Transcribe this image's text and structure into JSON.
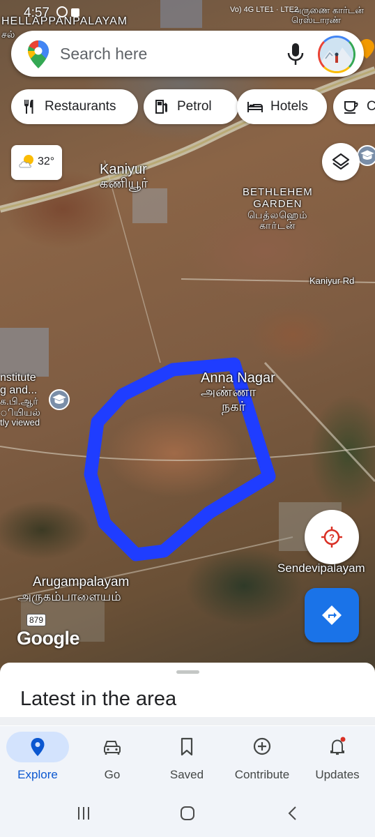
{
  "status_bar": {
    "time": "4:57",
    "network": "Vo) 4G LTE1 · LTE2",
    "battery": "%"
  },
  "search": {
    "placeholder": "Search here"
  },
  "chips": [
    {
      "label": "Restaurants",
      "icon": "fork-knife-icon"
    },
    {
      "label": "Petrol",
      "icon": "fuel-pump-icon"
    },
    {
      "label": "Hotels",
      "icon": "bed-icon"
    },
    {
      "label": "C",
      "icon": "coffee-cup-icon"
    }
  ],
  "weather": {
    "temp": "32°",
    "icon": "partly-cloudy-icon"
  },
  "map_labels": {
    "top_left": "HELLAPPANPALAYAM",
    "top_left_tamil": "சல்",
    "top_right_tamil": "அருணை கார்டன் ரெஸ்டாரண்",
    "kaniyur": "Kaniyur",
    "kaniyur_tamil": "கணியூர்",
    "bethlehem": "BETHLEHEM",
    "garden": "GARDEN",
    "bethlehem_tamil": "பெத்லஹெம்",
    "garden_tamil": "கார்டன்",
    "kaniyur_rd": "Kaniyur Rd",
    "anna_nagar": "Anna Nagar",
    "anna_nagar_tamil_1": "அண்ணா",
    "anna_nagar_tamil_2": "நகர்",
    "institute_1": "nstitute",
    "institute_2": "g and...",
    "institute_tamil_1": "க.பி.ஆர்",
    "institute_tamil_2": "ியியல்",
    "recently_viewed": "tly viewed",
    "arugampalayam": "Arugampalayam",
    "arugampalayam_tamil": "அருகம்பாளையம்",
    "sendevipalayam": "Sendevipalayam",
    "road_number": "879"
  },
  "branding": {
    "google": "Google"
  },
  "sheet": {
    "title": "Latest in the area"
  },
  "nav": [
    {
      "label": "Explore",
      "icon": "explore-pin-icon",
      "active": true
    },
    {
      "label": "Go",
      "icon": "car-icon"
    },
    {
      "label": "Saved",
      "icon": "bookmark-icon"
    },
    {
      "label": "Contribute",
      "icon": "plus-circle-icon"
    },
    {
      "label": "Updates",
      "icon": "bell-icon"
    }
  ],
  "colors": {
    "accent": "#1a73e8",
    "drawn_outline": "#1f3dff",
    "active_pill": "#d3e3fd"
  }
}
